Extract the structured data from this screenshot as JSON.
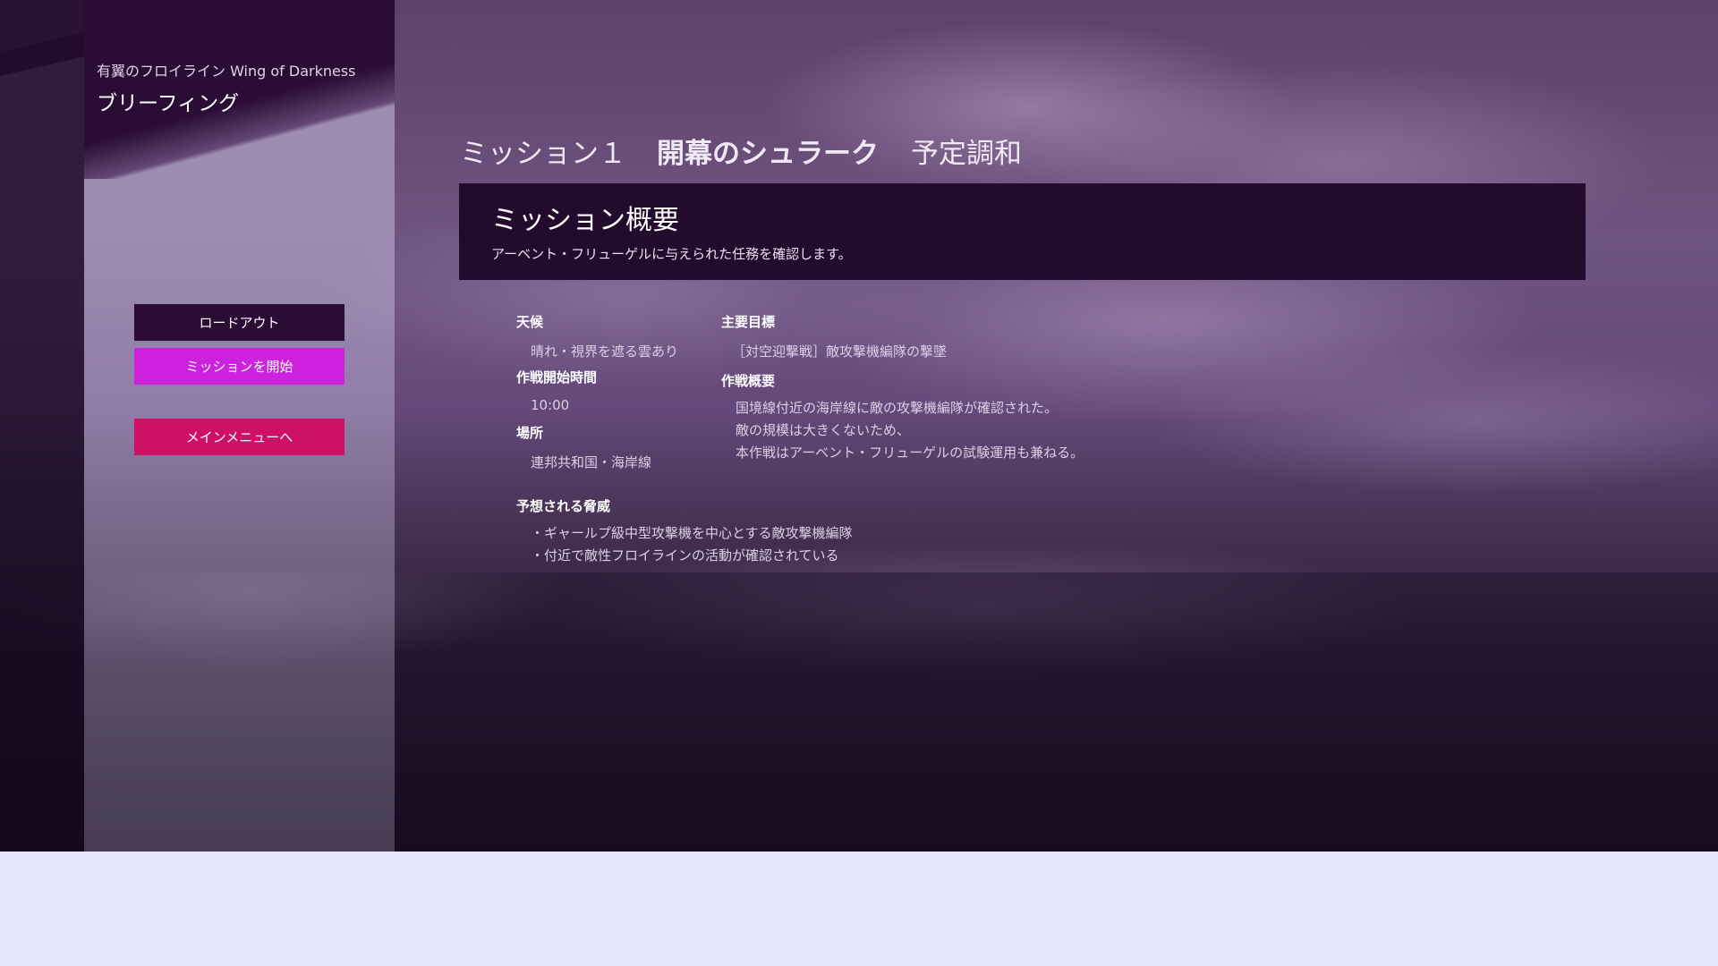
{
  "header": {
    "subtitle": "有翼のフロイライン Wing of Darkness",
    "title": "ブリーフィング"
  },
  "sidebar": {
    "loadout_label": "ロードアウト",
    "start_label": "ミッションを開始",
    "menu_label": "メインメニューへ"
  },
  "mission": {
    "number": "ミッション１",
    "name": "開幕のシュラーク",
    "subtitle": "予定調和"
  },
  "summary": {
    "title": "ミッション概要",
    "description": "アーベント・フリューゲルに与えられた任務を確認します。"
  },
  "details": {
    "weather_label": "天候",
    "weather_value": "晴れ・視界を遮る雲あり",
    "start_time_label": "作戦開始時間",
    "start_time_value": "10:00",
    "location_label": "場所",
    "location_value": "連邦共和国・海岸線",
    "objective_label": "主要目標",
    "objective_value": "［対空迎撃戦］敵攻撃機編隊の撃墜",
    "overview_label": "作戦概要",
    "overview_lines": [
      "国境線付近の海岸線に敵の攻撃機編隊が確認された。",
      "敵の規模は大きくないため、",
      "本作戦はアーベント・フリューゲルの試験運用も兼ねる。"
    ],
    "threats_label": "予想される脅威",
    "threat_lines": [
      "・ギャールプ級中型攻撃機を中心とする敵攻撃機編隊",
      "・付近で敵性フロイラインの活動が確認されている"
    ]
  }
}
